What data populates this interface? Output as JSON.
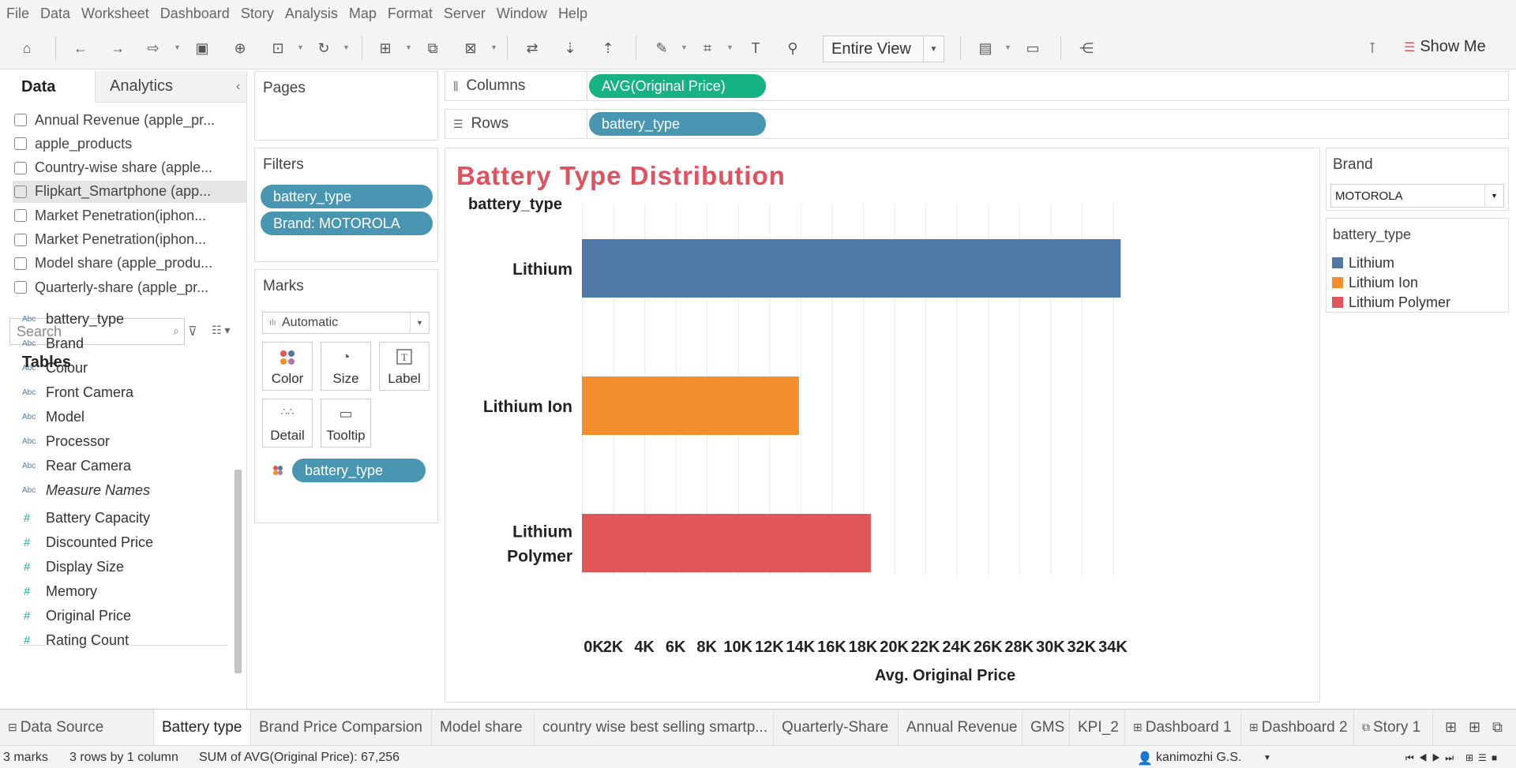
{
  "menu": [
    "File",
    "Data",
    "Worksheet",
    "Dashboard",
    "Story",
    "Analysis",
    "Map",
    "Format",
    "Server",
    "Window",
    "Help"
  ],
  "toolbar": {
    "fit_mode": "Entire View",
    "show_me": "Show Me"
  },
  "left_panel": {
    "tabs": {
      "data": "Data",
      "analytics": "Analytics"
    },
    "data_sources": [
      {
        "label": "Annual Revenue (apple_pr...",
        "active": false
      },
      {
        "label": "apple_products",
        "active": false
      },
      {
        "label": "Country-wise share (apple...",
        "active": false
      },
      {
        "label": "Flipkart_Smartphone (app...",
        "active": true
      },
      {
        "label": "Market Penetration(iphon...",
        "active": false
      },
      {
        "label": "Market Penetration(iphon...",
        "active": false
      },
      {
        "label": "Model share (apple_produ...",
        "active": false
      },
      {
        "label": "Quarterly-share (apple_pr...",
        "active": false
      }
    ],
    "search_placeholder": "Search",
    "tables_title": "Tables",
    "dimensions": [
      {
        "type": "Abc",
        "label": "battery_type"
      },
      {
        "type": "Abc",
        "label": "Brand"
      },
      {
        "type": "Abc",
        "label": "Colour"
      },
      {
        "type": "Abc",
        "label": "Front Camera"
      },
      {
        "type": "Abc",
        "label": "Model"
      },
      {
        "type": "Abc",
        "label": "Processor"
      },
      {
        "type": "Abc",
        "label": "Rear Camera"
      },
      {
        "type": "Abc",
        "label": "Measure Names"
      }
    ],
    "measures": [
      {
        "type": "#",
        "label": "Battery Capacity"
      },
      {
        "type": "#",
        "label": "Discounted Price"
      },
      {
        "type": "#",
        "label": "Display Size"
      },
      {
        "type": "#",
        "label": "Memory"
      },
      {
        "type": "#",
        "label": "Original Price"
      },
      {
        "type": "#",
        "label": "Rating Count"
      }
    ]
  },
  "pages": {
    "title": "Pages"
  },
  "filters": {
    "title": "Filters",
    "pills": [
      "battery_type",
      "Brand: MOTOROLA"
    ]
  },
  "marks": {
    "title": "Marks",
    "type": "Automatic",
    "buttons": {
      "color": "Color",
      "size": "Size",
      "label": "Label",
      "detail": "Detail",
      "tooltip": "Tooltip"
    },
    "color_pill": "battery_type"
  },
  "shelves": {
    "columns_label": "Columns",
    "columns_pill": "AVG(Original Price)",
    "rows_label": "Rows",
    "rows_pill": "battery_type"
  },
  "chart_data": {
    "type": "bar",
    "orientation": "horizontal",
    "title": "Battery Type Distribution",
    "row_header": "battery_type",
    "categories": [
      "Lithium",
      "Lithium Ion",
      "Lithium Polymer"
    ],
    "category_lines": [
      [
        "Lithium"
      ],
      [
        "Lithium Ion"
      ],
      [
        "Lithium",
        "Polymer"
      ]
    ],
    "values": [
      34500,
      13900,
      18500
    ],
    "colors": [
      "#4e79a7",
      "#f28e2b",
      "#e15759"
    ],
    "xlabel": "Avg. Original Price",
    "xlim": [
      0,
      36000
    ],
    "xticks": [
      0,
      2000,
      4000,
      6000,
      8000,
      10000,
      12000,
      14000,
      16000,
      18000,
      20000,
      22000,
      24000,
      26000,
      28000,
      30000,
      32000,
      34000
    ],
    "xtick_labels": [
      "0K",
      "2K",
      "4K",
      "6K",
      "8K",
      "10K",
      "12K",
      "14K",
      "16K",
      "18K",
      "20K",
      "22K",
      "24K",
      "26K",
      "28K",
      "30K",
      "32K",
      "34K"
    ],
    "grid": true
  },
  "brand_filter": {
    "title": "Brand",
    "value": "MOTOROLA"
  },
  "legend": {
    "title": "battery_type",
    "items": [
      {
        "label": "Lithium",
        "color": "#4e79a7"
      },
      {
        "label": "Lithium Ion",
        "color": "#f28e2b"
      },
      {
        "label": "Lithium Polymer",
        "color": "#e15759"
      }
    ]
  },
  "sheet_tabs": [
    {
      "label": "Data Source",
      "icon": "⊟",
      "active": false
    },
    {
      "label": "Battery type",
      "active": true
    },
    {
      "label": "Brand Price Comparsion",
      "active": false
    },
    {
      "label": "Model share",
      "active": false
    },
    {
      "label": "country wise best selling smartp...",
      "active": false
    },
    {
      "label": "Quarterly-Share",
      "active": false
    },
    {
      "label": "Annual Revenue",
      "active": false
    },
    {
      "label": "GMS",
      "active": false
    },
    {
      "label": "KPI_2",
      "active": false
    },
    {
      "label": "Dashboard 1",
      "icon": "⊞",
      "active": false
    },
    {
      "label": "Dashboard 2",
      "icon": "⊞",
      "active": false
    },
    {
      "label": "Story 1",
      "icon": "⧉",
      "active": false
    }
  ],
  "status": {
    "marks": "3 marks",
    "dims": "3 rows by 1 column",
    "sum": "SUM of AVG(Original Price): 67,256",
    "user": "kanimozhi G.S."
  }
}
